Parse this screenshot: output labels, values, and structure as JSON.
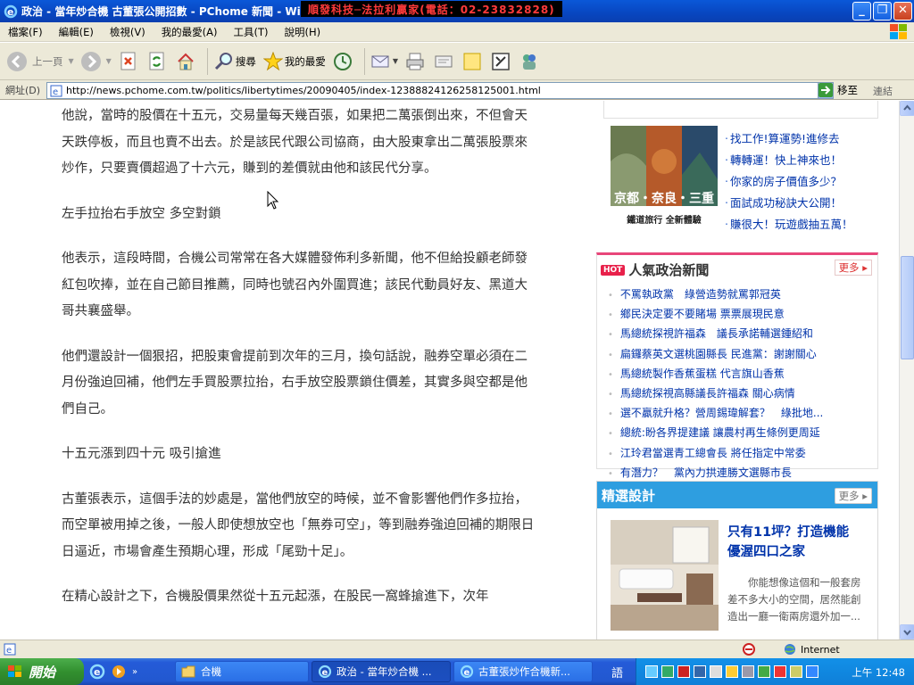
{
  "window": {
    "title": "政治 - 當年炒合機 古董張公開招數 - PChome 新聞 - Wi",
    "marquee": "順發科技─法拉利贏家(電話：02-23832828)",
    "minimize": "_",
    "restore": "❐",
    "close": "✕"
  },
  "menu": [
    "檔案(F)",
    "編輯(E)",
    "檢視(V)",
    "我的最愛(A)",
    "工具(T)",
    "說明(H)"
  ],
  "toolbar": {
    "back_label": "上一頁",
    "search_label": "搜尋",
    "favorites_label": "我的最愛"
  },
  "address": {
    "label": "網址(D)",
    "url": "http://news.pchome.com.tw/politics/libertytimes/20090405/index-12388824126258125001.html",
    "go_label": "移至",
    "links_label": "連結"
  },
  "article": {
    "paragraphs": [
      "他說，當時的股價在十五元，交易量每天幾百張，如果把二萬張倒出來，不但會天天跌停板，而且也賣不出去。於是該民代跟公司協商，由大股東拿出二萬張股票來炒作，只要賣價超過了十六元，賺到的差價就由他和該民代分享。",
      "左手拉抬右手放空 多空對鎖",
      "他表示，這段時間，合機公司常常在各大媒體發佈利多新聞，他不但給投顧老師發紅包吹捧，並在自己節目推薦，同時也號召內外圍買進；該民代動員好友、黑道大哥共襄盛舉。",
      "他們還設計一個狠招，把股東會提前到次年的三月，換句話說，融券空單必須在二月份強迫回補，他們左手買股票拉抬，右手放空股票鎖住價差，其實多與空都是他們自己。",
      "十五元漲到四十元 吸引搶進",
      "古董張表示，這個手法的妙處是，當他們放空的時候，並不會影響他們作多拉抬，而空單被用掉之後，一般人即使想放空也「無券可空」，等到融券強迫回補的期限日日逼近，市場會產生預期心理，形成「尾勁十足」。",
      "在精心設計之下，合機股價果然從十五元起漲，在股民一窩蜂搶進下，次年"
    ]
  },
  "promo": {
    "image_caption": "京都・奈良・三重",
    "image_sub": "鐵道旅行 全新體驗",
    "links": [
      "找工作!算運勢!進修去",
      "轉轉運！快上神來也！",
      "你家的房子價值多少？",
      "面試成功秘訣大公開！",
      "賺很大！玩遊戲抽五萬！"
    ]
  },
  "hot_news": {
    "tag": "HOT",
    "title": "人氣政治新聞",
    "more": "更多 ▸",
    "items": [
      "不罵執政黨　綠營造勢就罵郭冠英",
      "鄉民決定要不要賭場 票票展現民意",
      "馬總統探視許福森　議長承諾輔選鍾紹和",
      "扁鑼蔡英文選桃園縣長 民進黨：謝謝關心",
      "馬總統製作香蕉蛋糕 代言旗山香蕉",
      "馬總統探視高縣議長許福森 關心病情",
      "選不贏就升格？營周錫瑋解套？　綠批地...",
      "總統:盼各界提建議 讓農村再生條例更周延",
      "江玲君當選青工總會長 將任指定中常委",
      "有潛力？　黨內力拱連勝文選縣市長"
    ]
  },
  "design": {
    "title": "精選設計",
    "more": "更多 ▸",
    "headline": "只有11坪？打造機能優渥四口之家",
    "desc": "你能想像這個和一般套房差不多大小的空間，居然能創造出一廳一衛兩房還外加一..."
  },
  "status": {
    "zone": "Internet"
  },
  "taskbar": {
    "start": "開始",
    "tasks": [
      "合機",
      "政治 - 當年炒合機 ...",
      "古董張炒作合機新..."
    ],
    "ime": "語",
    "clock": "上午 12:48"
  },
  "colors": {
    "accent_blue": "#2e9ee0",
    "hot_pink": "#e8467a",
    "link_blue": "#0033aa"
  }
}
